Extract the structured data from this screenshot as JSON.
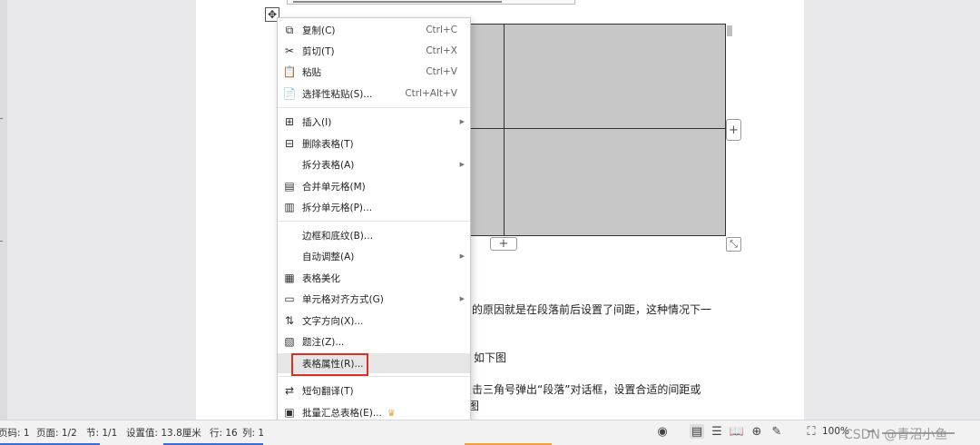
{
  "document": {
    "text_lines": [
      "出的原因就是在段落前后设置了间距，这种情况下一",
      "，如下图",
      "点击三角号弹出“段落”对话框，设置合适的间距或",
      "图"
    ]
  },
  "table_controls": {
    "move_glyph": "✥",
    "add_glyph": "+",
    "resize_glyph": "⤡"
  },
  "context_menu": {
    "items": [
      {
        "icon": "copy-icon",
        "glyph": "⧉",
        "label": "复制(C)",
        "shortcut": "Ctrl+C"
      },
      {
        "icon": "scissors-icon",
        "glyph": "✂",
        "label": "剪切(T)",
        "shortcut": "Ctrl+X"
      },
      {
        "icon": "paste-icon",
        "glyph": "📋",
        "label": "粘贴",
        "shortcut": "Ctrl+V"
      },
      {
        "icon": "paste-special-icon",
        "glyph": "📄",
        "label": "选择性粘贴(S)...",
        "shortcut": "Ctrl+Alt+V"
      },
      {
        "icon": "table-insert-icon",
        "glyph": "⊞",
        "label": "插入(I)",
        "submenu": true
      },
      {
        "icon": "table-delete-icon",
        "glyph": "⊟",
        "label": "删除表格(T)"
      },
      {
        "icon": "",
        "glyph": "",
        "label": "拆分表格(A)",
        "submenu": true
      },
      {
        "icon": "merge-cells-icon",
        "glyph": "▤",
        "label": "合并单元格(M)"
      },
      {
        "icon": "split-cells-icon",
        "glyph": "▥",
        "label": "拆分单元格(P)..."
      },
      {
        "icon": "",
        "glyph": "",
        "label": "边框和底纹(B)..."
      },
      {
        "icon": "",
        "glyph": "",
        "label": "自动调整(A)",
        "submenu": true
      },
      {
        "icon": "table-beautify-icon",
        "glyph": "▦",
        "label": "表格美化"
      },
      {
        "icon": "cell-align-icon",
        "glyph": "▭",
        "label": "单元格对齐方式(G)",
        "submenu": true
      },
      {
        "icon": "text-direction-icon",
        "glyph": "⇅",
        "label": "文字方向(X)..."
      },
      {
        "icon": "caption-icon",
        "glyph": "▧",
        "label": "题注(Z)..."
      },
      {
        "icon": "",
        "glyph": "",
        "label": "表格属性(R)...",
        "highlighted": true
      },
      {
        "icon": "translate-icon",
        "glyph": "⇄",
        "label": "短句翻译(T)"
      },
      {
        "icon": "batch-summary-icon",
        "glyph": "▣",
        "label": "批量汇总表格(E)...",
        "badge": "crown-icon"
      }
    ],
    "more_glyph": "⌄"
  },
  "status_bar": {
    "page_code": "页码: 1",
    "page": "页面: 1/2",
    "section": "节: 1/1",
    "setting": "设置值: 13.8厘米",
    "row": "行: 16",
    "column": "列: 1",
    "zoom": "100%",
    "icons": {
      "eye": "◉",
      "page_view": "▤",
      "outline": "☰",
      "read": "📖",
      "web": "⊕",
      "pen": "✎",
      "fit": "⛶",
      "minus": "−",
      "plus": "+"
    }
  },
  "watermark": "CSDN @青沼小鱼",
  "colors": {
    "highlight_box": "#d93025",
    "table_fill": "#c7c7c7",
    "accent_blue": "#3c6bd6"
  }
}
